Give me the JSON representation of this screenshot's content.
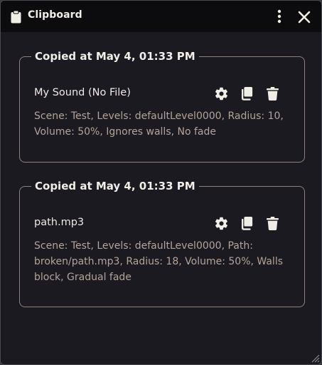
{
  "window": {
    "title": "Clipboard",
    "icons": {
      "title": "clipboard-icon",
      "menu": "kebab-menu-icon",
      "close": "close-icon",
      "resize": "resize-grip-icon"
    }
  },
  "entries": [
    {
      "copied_at": "Copied at May 4, 01:33 PM",
      "name": "My Sound (No File)",
      "description": "Scene: Test, Levels: defaultLevel0000, Radius: 10, Volume: 50%, Ignores walls, No fade"
    },
    {
      "copied_at": "Copied at May 4, 01:33 PM",
      "name": "path.mp3",
      "description": "Scene: Test, Levels: defaultLevel0000, Path: broken/path.mp3, Radius: 18, Volume: 50%, Walls block, Gradual fade"
    }
  ],
  "entry_actions": [
    "gear-icon",
    "copy-icon",
    "trash-icon"
  ],
  "colors": {
    "background": "#1b1a20",
    "titlebar": "#0c0c0e",
    "card_border": "#8f817a",
    "text": "#f1eee8",
    "muted_text": "#b4a398"
  }
}
